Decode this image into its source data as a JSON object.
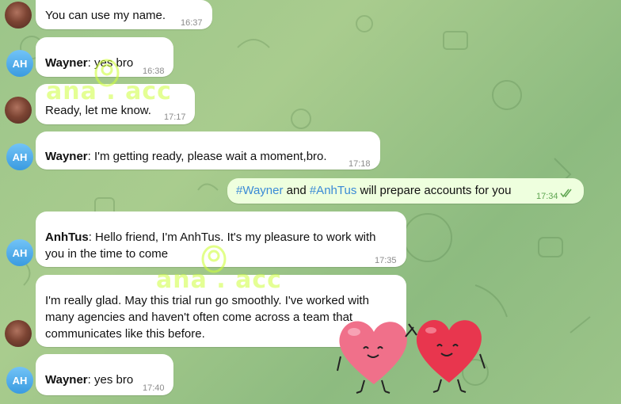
{
  "messages": [
    {
      "text": "You can use my name.",
      "time": "16:37"
    },
    {
      "sender": "Wayner",
      "text": ": yes bro",
      "time": "16:38",
      "avatar": "AH"
    },
    {
      "text": "Ready, let me know.",
      "time": "17:17"
    },
    {
      "sender": "Wayner",
      "text": ": I'm getting ready, please wait a moment,bro.",
      "time": "17:18",
      "avatar": "AH"
    },
    {
      "tag1": "#Wayner",
      "mid": " and ",
      "tag2": "#AnhTus",
      "text": " will prepare accounts for you",
      "time": "17:34"
    },
    {
      "sender": "AnhTus",
      "line1": ": Hello friend, I'm AnhTus. It's my pleasure to work with",
      "line2": "you in the time to come",
      "time": "17:35",
      "avatar": "AH"
    },
    {
      "line1": "I'm really glad. May this trial run go smoothly. I've worked with",
      "line2": "many agencies and haven't often come across a team that",
      "line3": "communicates like this before.",
      "time": ""
    },
    {
      "sender": "Wayner",
      "text": ": yes bro",
      "time": "17:40",
      "avatar": "AH"
    }
  ],
  "watermark": "ana . acc",
  "colors": {
    "outgoing_bubble": "#eeffde",
    "incoming_bubble": "#ffffff",
    "hashtag": "#3a8ad6",
    "heart_pink": "#f0708a",
    "heart_red": "#e8364e"
  }
}
